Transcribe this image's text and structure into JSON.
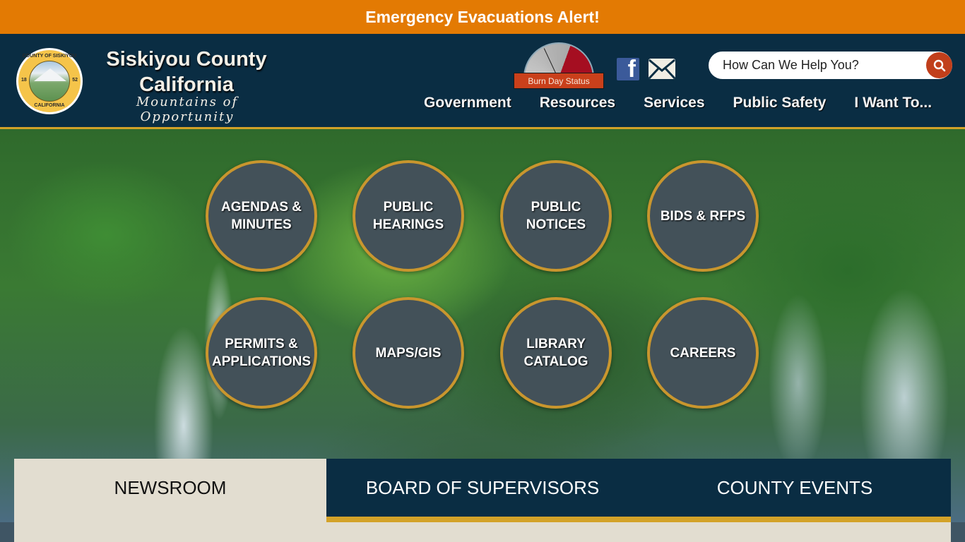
{
  "alert": {
    "text": "Emergency Evacuations Alert!",
    "color": "#e37a03"
  },
  "header": {
    "title_line1": "Siskiyou County",
    "title_line2": "California",
    "tagline": "Mountains of Opportunity",
    "seal": {
      "top_text": "COUNTY OF SISKIYOU",
      "bottom_text": "CALIFORNIA",
      "year_left": "18",
      "year_right": "52"
    },
    "burn_day_label": "Burn Day Status",
    "social": {
      "facebook": "facebook-icon",
      "email": "mail-icon"
    },
    "search": {
      "placeholder": "How Can We Help You?",
      "value": ""
    }
  },
  "nav": [
    {
      "label": "Government"
    },
    {
      "label": "Resources"
    },
    {
      "label": "Services"
    },
    {
      "label": "Public Safety"
    },
    {
      "label": "I Want To..."
    }
  ],
  "quick_links": [
    {
      "line1": "AGENDAS &",
      "line2": "MINUTES"
    },
    {
      "line1": "PUBLIC",
      "line2": "HEARINGS"
    },
    {
      "line1": "PUBLIC",
      "line2": "NOTICES"
    },
    {
      "line1": "BIDS & RFPS",
      "line2": ""
    },
    {
      "line1": "PERMITS &",
      "line2": "APPLICATIONS"
    },
    {
      "line1": "MAPS/GIS",
      "line2": ""
    },
    {
      "line1": "LIBRARY",
      "line2": "CATALOG"
    },
    {
      "line1": "CAREERS",
      "line2": ""
    }
  ],
  "tabs": [
    {
      "label": "NEWSROOM",
      "active": true
    },
    {
      "label": "BOARD OF SUPERVISORS",
      "active": false
    },
    {
      "label": "COUNTY EVENTS",
      "active": false
    }
  ],
  "colors": {
    "navy": "#0a2d43",
    "gold": "#d3a228",
    "burn_red": "#c9401b",
    "tile": "#435159"
  }
}
